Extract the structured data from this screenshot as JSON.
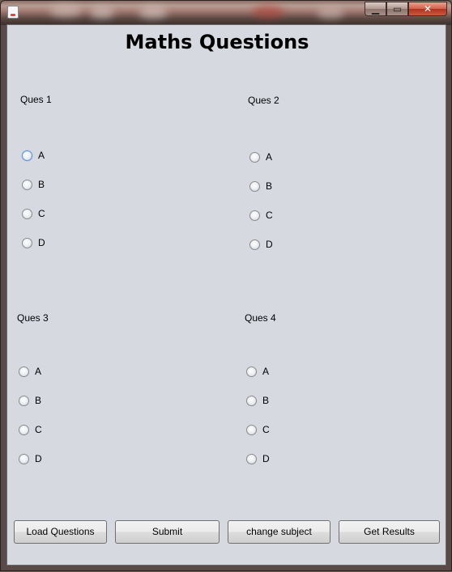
{
  "window": {
    "title": "",
    "buttons": {
      "minimize": "▁",
      "maximize": "▭",
      "close": "✕"
    }
  },
  "page": {
    "heading": "Maths Questions"
  },
  "questions": [
    {
      "label": "Ques 1",
      "options": [
        "A",
        "B",
        "C",
        "D"
      ]
    },
    {
      "label": "Ques 2",
      "options": [
        "A",
        "B",
        "C",
        "D"
      ]
    },
    {
      "label": "Ques 3",
      "options": [
        "A",
        "B",
        "C",
        "D"
      ]
    },
    {
      "label": "Ques 4",
      "options": [
        "A",
        "B",
        "C",
        "D"
      ]
    }
  ],
  "buttons": {
    "load": "Load Questions",
    "submit": "Submit",
    "change_subject": "change subject",
    "results": "Get Results"
  },
  "icons": {
    "app": "java-app-icon"
  }
}
